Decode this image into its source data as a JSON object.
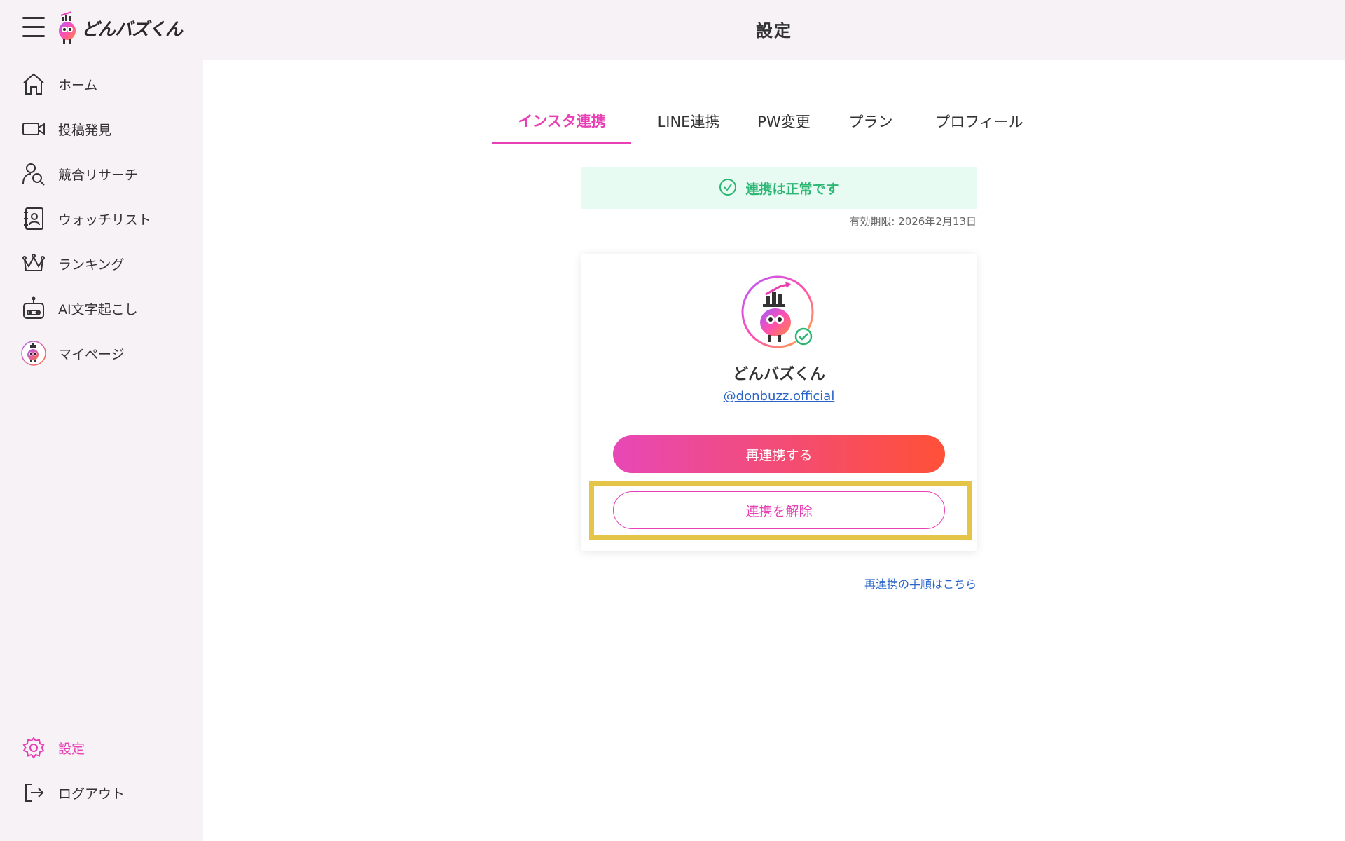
{
  "app": {
    "logo_text": "どんバズくん"
  },
  "header": {
    "title": "設定"
  },
  "sidebar": {
    "items": [
      {
        "label": "ホーム",
        "icon": "home-icon"
      },
      {
        "label": "投稿発見",
        "icon": "video-camera-icon"
      },
      {
        "label": "競合リサーチ",
        "icon": "user-search-icon"
      },
      {
        "label": "ウォッチリスト",
        "icon": "address-book-icon"
      },
      {
        "label": "ランキング",
        "icon": "crown-icon"
      },
      {
        "label": "AI文字起こし",
        "icon": "robot-icon"
      },
      {
        "label": "マイページ",
        "icon": "avatar-icon"
      }
    ],
    "bottom_items": [
      {
        "label": "設定",
        "icon": "gear-icon",
        "active": true
      },
      {
        "label": "ログアウト",
        "icon": "logout-icon"
      }
    ]
  },
  "tabs": [
    {
      "label": "インスタ連携",
      "active": true
    },
    {
      "label": "LINE連携"
    },
    {
      "label": "PW変更"
    },
    {
      "label": "プラン"
    },
    {
      "label": "プロフィール"
    }
  ],
  "status": {
    "text": "連携は正常です",
    "expiry": "有効期限: 2026年2月13日"
  },
  "account": {
    "name": "どんバズくん",
    "handle": "@donbuzz.official"
  },
  "actions": {
    "reconnect_label": "再連携する",
    "disconnect_label": "連携を解除",
    "help_link": "再連携の手順はこちら"
  },
  "colors": {
    "accent": "#e83fb4",
    "gradient_start": "#e748b6",
    "gradient_end": "#ff5037",
    "success": "#2bb673",
    "link": "#2a64c9",
    "highlight": "#e5c548"
  }
}
